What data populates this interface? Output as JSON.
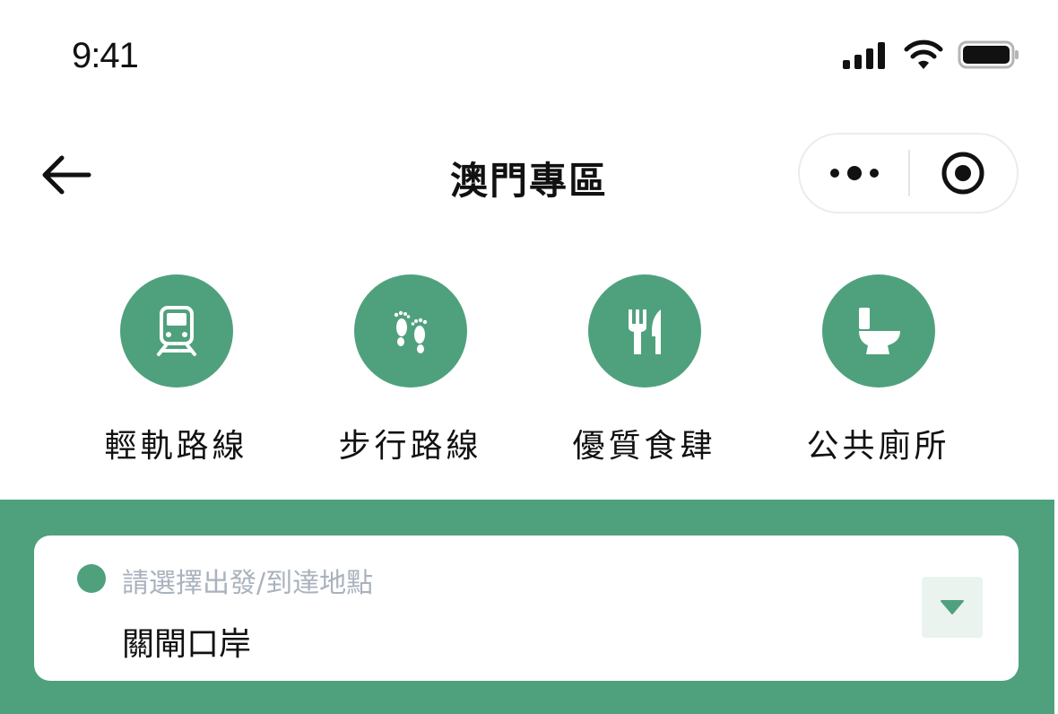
{
  "status_bar": {
    "time": "9:41",
    "icons": [
      "signal-icon",
      "wifi-icon",
      "battery-icon"
    ]
  },
  "nav": {
    "title": "澳門專區",
    "icons": [
      "back-arrow-icon",
      "more-dots-icon",
      "target-close-icon"
    ]
  },
  "features": [
    {
      "label": "輕軌路線",
      "icon": "light-rail-icon"
    },
    {
      "label": "步行路線",
      "icon": "footprints-icon"
    },
    {
      "label": "優質食肆",
      "icon": "fork-knife-icon"
    },
    {
      "label": "公共廁所",
      "icon": "toilet-icon"
    }
  ],
  "location_picker": {
    "hint": "請選擇出發/到達地點",
    "value": "關閘口岸",
    "icon": "dropdown-triangle-icon"
  },
  "colors": {
    "accent": "#4fa17e",
    "dropdown_bg": "#eaf3ee",
    "hint_text": "#a9b2bd"
  }
}
